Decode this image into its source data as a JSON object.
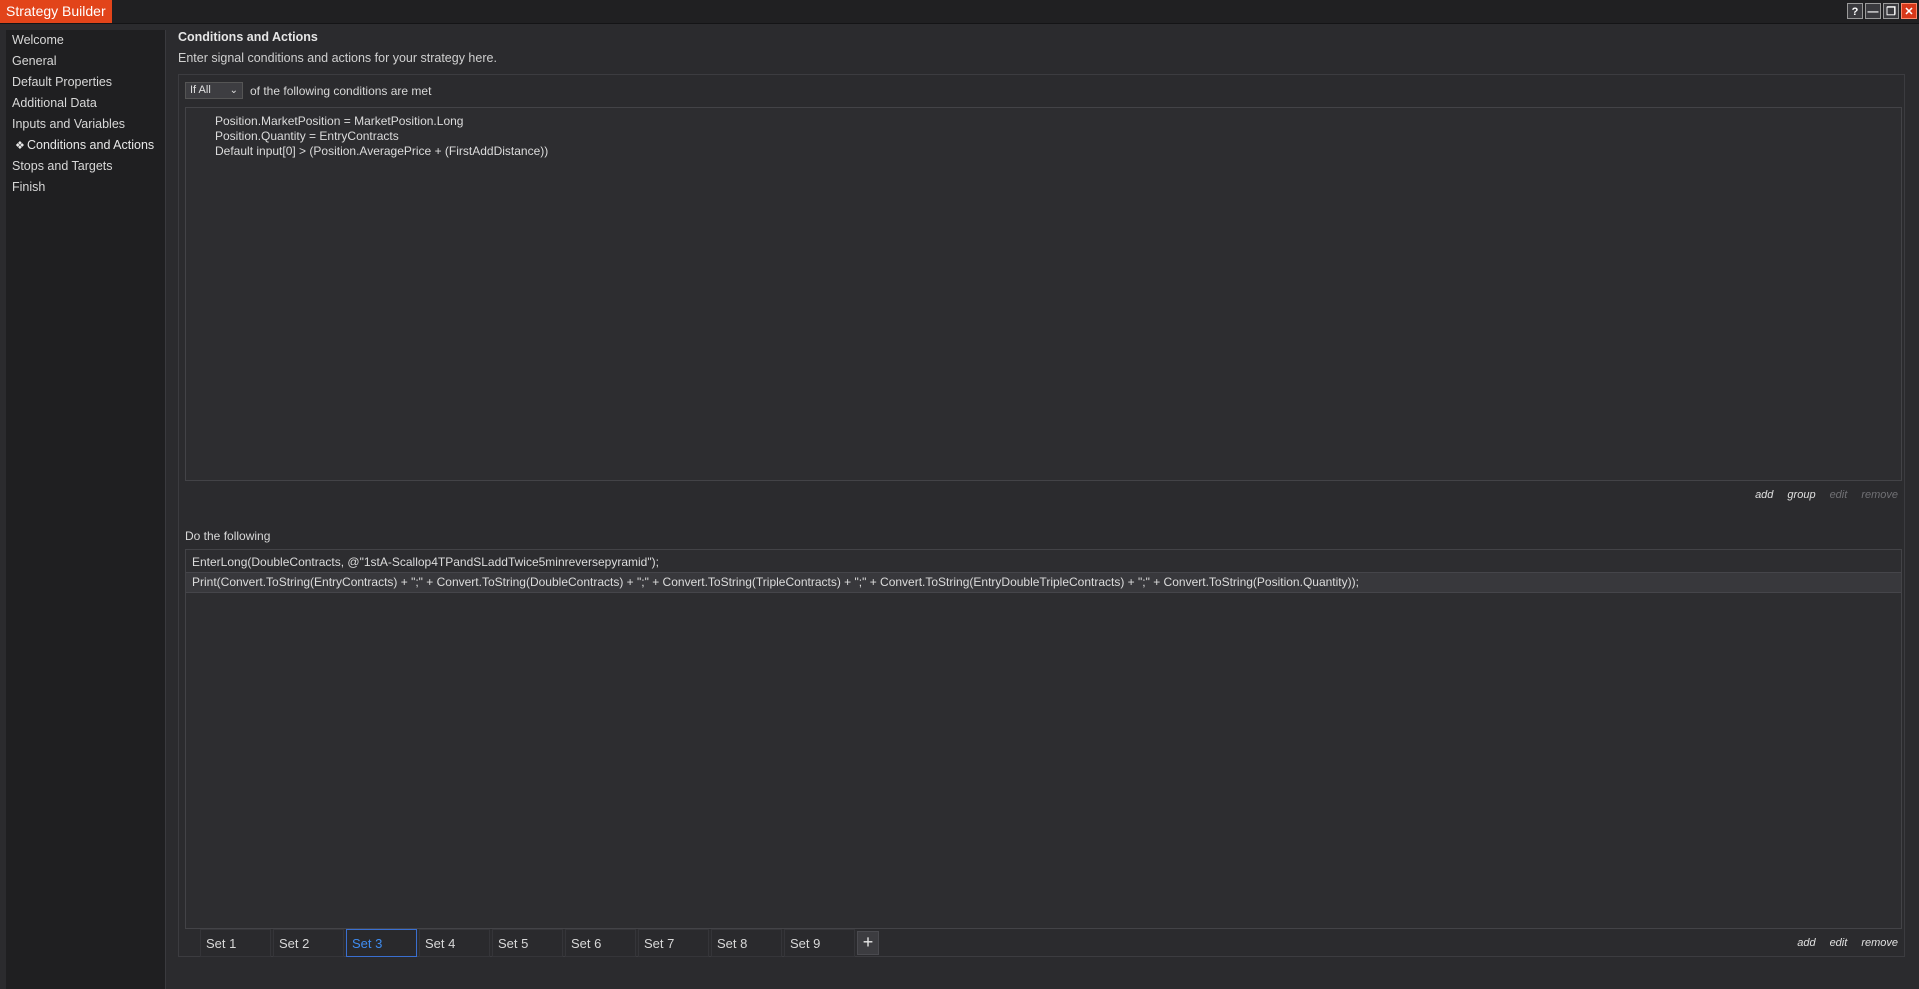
{
  "app": {
    "title": "Strategy Builder"
  },
  "window_buttons": {
    "help": "?",
    "minimize": "—",
    "restore": "❐",
    "close": "✕"
  },
  "sidebar": {
    "items": [
      {
        "label": "Welcome"
      },
      {
        "label": "General"
      },
      {
        "label": "Default Properties"
      },
      {
        "label": "Additional Data"
      },
      {
        "label": "Inputs and Variables"
      },
      {
        "label": "Conditions and Actions",
        "bullet": "❖"
      },
      {
        "label": "Stops and Targets"
      },
      {
        "label": "Finish"
      }
    ]
  },
  "main": {
    "heading": "Conditions and Actions",
    "subheading": "Enter signal conditions and actions for your strategy here.",
    "condition_select": {
      "value": "If All",
      "chevron": "⌄"
    },
    "condition_suffix": "of the following conditions are met",
    "conditions": [
      "Position.MarketPosition = MarketPosition.Long",
      "Position.Quantity = EntryContracts",
      "Default input[0] > (Position.AveragePrice + (FirstAddDistance))"
    ],
    "condition_links": {
      "add": "add",
      "group": "group",
      "edit": "edit",
      "remove": "remove"
    },
    "do_label": "Do the following",
    "actions": [
      "EnterLong(DoubleContracts, @\"1stA-Scallop4TPandSLaddTwice5minreversepyramid\");",
      "Print(Convert.ToString(EntryContracts) + \";\" + Convert.ToString(DoubleContracts) + \";\" + Convert.ToString(TripleContracts) + \";\" + Convert.ToString(EntryDoubleTripleContracts) + \";\" + Convert.ToString(Position.Quantity));"
    ],
    "action_links": {
      "add": "add",
      "edit": "edit",
      "remove": "remove"
    }
  },
  "sets": {
    "tabs": [
      "Set 1",
      "Set 2",
      "Set 3",
      "Set 4",
      "Set 5",
      "Set 6",
      "Set 7",
      "Set 8",
      "Set 9"
    ],
    "active": "Set 3",
    "add": "+"
  },
  "colors": {
    "accent": "#e2441a",
    "tab_active": "#3f8cf0"
  }
}
